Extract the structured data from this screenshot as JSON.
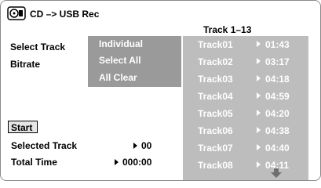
{
  "header": {
    "title": "CD –> USB Rec",
    "icon": "cd-usb-icon"
  },
  "track_panel": {
    "range_label": "Track  1–13"
  },
  "menu": {
    "select_track": "Select Track",
    "bitrate": "Bitrate"
  },
  "submenu": {
    "individual": "Individual",
    "select_all": "Select All",
    "all_clear": "All Clear"
  },
  "tracks": [
    {
      "name": "Track01",
      "time": "01:43"
    },
    {
      "name": "Track02",
      "time": "03:17"
    },
    {
      "name": "Track03",
      "time": "04:18"
    },
    {
      "name": "Track04",
      "time": "04:59"
    },
    {
      "name": "Track05",
      "time": "04:20"
    },
    {
      "name": "Track06",
      "time": "04:38"
    },
    {
      "name": "Track07",
      "time": "04:40"
    },
    {
      "name": "Track08",
      "time": "04:11"
    }
  ],
  "start_button": "Start",
  "info": {
    "selected_track_label": "Selected Track",
    "selected_track_value": "00",
    "total_time_label": "Total Time",
    "total_time_value": "000:00"
  }
}
